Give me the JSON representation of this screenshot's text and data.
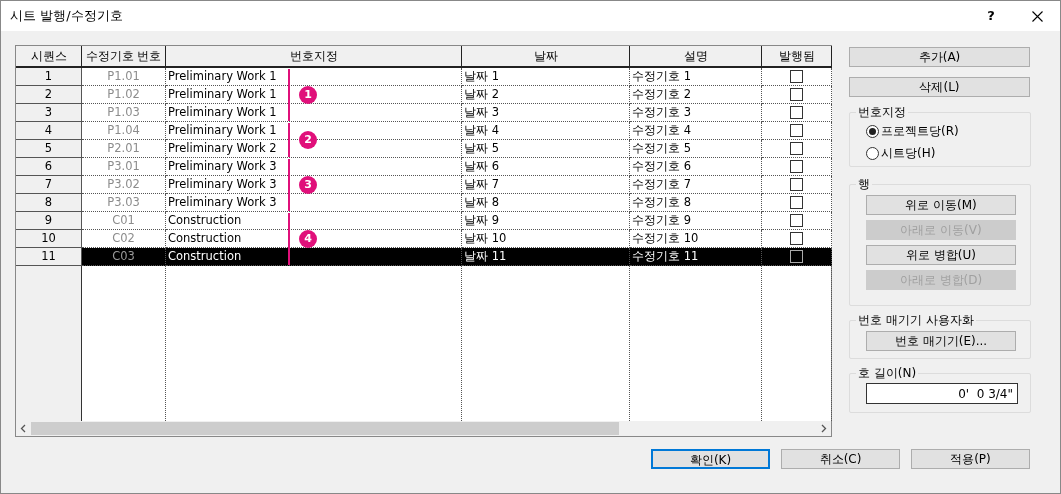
{
  "window": {
    "title": "시트 발행/수정기호",
    "help": "?"
  },
  "table": {
    "columns": [
      "시퀀스",
      "수정기호 번호",
      "번호지정",
      "날짜",
      "설명",
      "발행됨"
    ],
    "groups": [
      {
        "badge": "1",
        "rows": [
          {
            "sequence": "1",
            "number": "P1.01",
            "numbering": "Preliminary Work 1",
            "date": "날짜 1",
            "description": "수정기호 1",
            "issued": false,
            "selected": false
          },
          {
            "sequence": "2",
            "number": "P1.02",
            "numbering": "Preliminary Work 1",
            "date": "날짜 2",
            "description": "수정기호 2",
            "issued": false,
            "selected": false
          },
          {
            "sequence": "3",
            "number": "P1.03",
            "numbering": "Preliminary Work 1",
            "date": "날짜 3",
            "description": "수정기호 3",
            "issued": false,
            "selected": false
          }
        ]
      },
      {
        "badge": "2",
        "rows": [
          {
            "sequence": "4",
            "number": "P1.04",
            "numbering": "Preliminary Work 1",
            "date": "날짜 4",
            "description": "수정기호 4",
            "issued": false,
            "selected": false
          },
          {
            "sequence": "5",
            "number": "P2.01",
            "numbering": "Preliminary Work 2",
            "date": "날짜 5",
            "description": "수정기호 5",
            "issued": false,
            "selected": false
          }
        ]
      },
      {
        "badge": "3",
        "rows": [
          {
            "sequence": "6",
            "number": "P3.01",
            "numbering": "Preliminary Work 3",
            "date": "날짜 6",
            "description": "수정기호 6",
            "issued": false,
            "selected": false
          },
          {
            "sequence": "7",
            "number": "P3.02",
            "numbering": "Preliminary Work 3",
            "date": "날짜 7",
            "description": "수정기호 7",
            "issued": false,
            "selected": false
          },
          {
            "sequence": "8",
            "number": "P3.03",
            "numbering": "Preliminary Work 3",
            "date": "날짜 8",
            "description": "수정기호 8",
            "issued": false,
            "selected": false
          }
        ]
      },
      {
        "badge": "4",
        "rows": [
          {
            "sequence": "9",
            "number": "C01",
            "numbering": "Construction",
            "date": "날짜 9",
            "description": "수정기호 9",
            "issued": false,
            "selected": false
          },
          {
            "sequence": "10",
            "number": "C02",
            "numbering": "Construction",
            "date": "날짜 10",
            "description": "수정기호 10",
            "issued": false,
            "selected": false
          },
          {
            "sequence": "11",
            "number": "C03",
            "numbering": "Construction",
            "date": "날짜 11",
            "description": "수정기호 11",
            "issued": false,
            "selected": true
          }
        ]
      }
    ]
  },
  "side_buttons": [
    {
      "label": "추가(A)",
      "disabled": false
    },
    {
      "label": "삭제(L)",
      "disabled": false
    }
  ],
  "numbering": {
    "title": "번호지정",
    "options": [
      {
        "label": "프로젝트당(R)",
        "selected": true
      },
      {
        "label": "시트당(H)",
        "selected": false
      }
    ]
  },
  "row_group": {
    "title": "행",
    "buttons": [
      {
        "label": "위로 이동(M)",
        "disabled": false
      },
      {
        "label": "아래로 이동(V)",
        "disabled": true
      },
      {
        "label": "위로 병합(U)",
        "disabled": false
      },
      {
        "label": "아래로 병합(D)",
        "disabled": true
      }
    ]
  },
  "customize": {
    "title": "번호 매기기 사용자화",
    "button": "번호 매기기(E)..."
  },
  "arc_length": {
    "title": "호 길이(N)",
    "value": "0'  0 3/4\""
  },
  "footer_buttons": [
    {
      "label": "확인(K)",
      "focused": true
    },
    {
      "label": "취소(C)",
      "focused": false
    },
    {
      "label": "적용(P)",
      "focused": false
    }
  ]
}
